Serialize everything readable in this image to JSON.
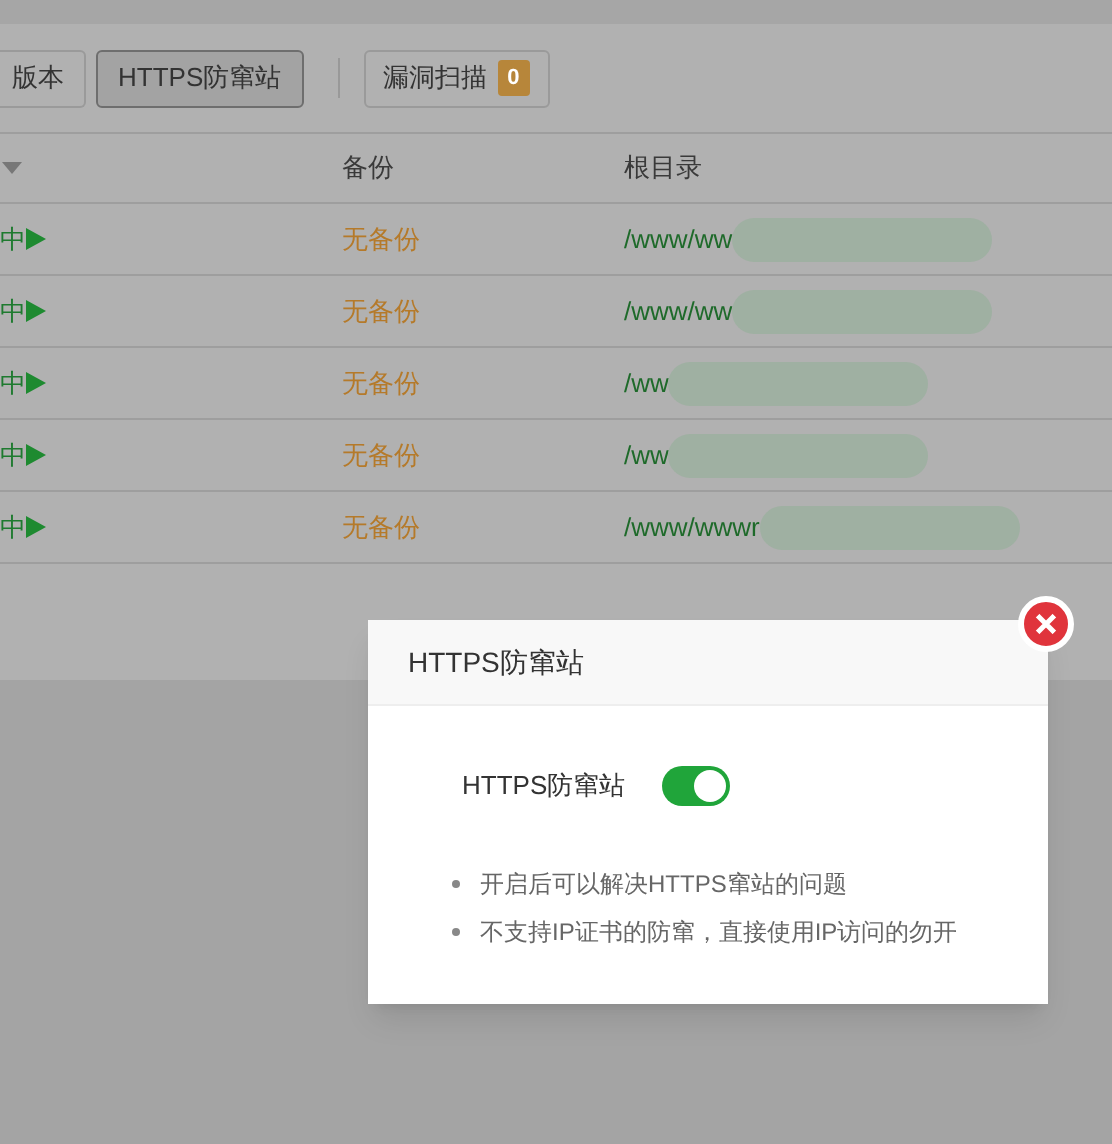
{
  "toolbar": {
    "buttons": [
      {
        "label": "版本",
        "selected": false
      },
      {
        "label": "HTTPS防窜站",
        "selected": true
      }
    ],
    "scan_button": {
      "label": "漏洞扫描",
      "badge": "0"
    }
  },
  "table": {
    "columns": [
      "",
      "备份",
      "根目录"
    ],
    "rows": [
      {
        "status": "中",
        "backup": "无备份",
        "path": "/www/ww"
      },
      {
        "status": "中",
        "backup": "无备份",
        "path": "/www/ww"
      },
      {
        "status": "中",
        "backup": "无备份",
        "path": "/ww"
      },
      {
        "status": "中",
        "backup": "无备份",
        "path": "/ww"
      },
      {
        "status": "中",
        "backup": "无备份",
        "path": "/www/wwwr"
      }
    ]
  },
  "dialog": {
    "title": "HTTPS防窜站",
    "setting": {
      "label": "HTTPS防窜站",
      "on": true
    },
    "notes": [
      "开启后可以解决HTTPS窜站的问题",
      "不支持IP证书的防窜，直接使用IP访问的勿开"
    ]
  }
}
